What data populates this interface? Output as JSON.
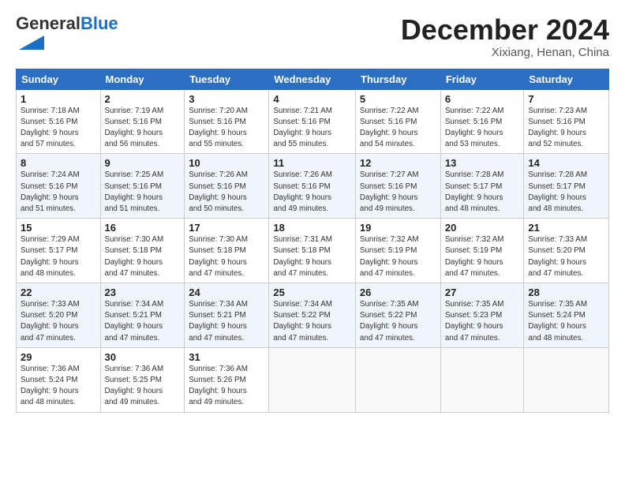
{
  "header": {
    "logo_general": "General",
    "logo_blue": "Blue",
    "month_title": "December 2024",
    "location": "Xixiang, Henan, China"
  },
  "weekdays": [
    "Sunday",
    "Monday",
    "Tuesday",
    "Wednesday",
    "Thursday",
    "Friday",
    "Saturday"
  ],
  "weeks": [
    [
      {
        "day": "1",
        "info": "Sunrise: 7:18 AM\nSunset: 5:16 PM\nDaylight: 9 hours\nand 57 minutes."
      },
      {
        "day": "2",
        "info": "Sunrise: 7:19 AM\nSunset: 5:16 PM\nDaylight: 9 hours\nand 56 minutes."
      },
      {
        "day": "3",
        "info": "Sunrise: 7:20 AM\nSunset: 5:16 PM\nDaylight: 9 hours\nand 55 minutes."
      },
      {
        "day": "4",
        "info": "Sunrise: 7:21 AM\nSunset: 5:16 PM\nDaylight: 9 hours\nand 55 minutes."
      },
      {
        "day": "5",
        "info": "Sunrise: 7:22 AM\nSunset: 5:16 PM\nDaylight: 9 hours\nand 54 minutes."
      },
      {
        "day": "6",
        "info": "Sunrise: 7:22 AM\nSunset: 5:16 PM\nDaylight: 9 hours\nand 53 minutes."
      },
      {
        "day": "7",
        "info": "Sunrise: 7:23 AM\nSunset: 5:16 PM\nDaylight: 9 hours\nand 52 minutes."
      }
    ],
    [
      {
        "day": "8",
        "info": "Sunrise: 7:24 AM\nSunset: 5:16 PM\nDaylight: 9 hours\nand 51 minutes."
      },
      {
        "day": "9",
        "info": "Sunrise: 7:25 AM\nSunset: 5:16 PM\nDaylight: 9 hours\nand 51 minutes."
      },
      {
        "day": "10",
        "info": "Sunrise: 7:26 AM\nSunset: 5:16 PM\nDaylight: 9 hours\nand 50 minutes."
      },
      {
        "day": "11",
        "info": "Sunrise: 7:26 AM\nSunset: 5:16 PM\nDaylight: 9 hours\nand 49 minutes."
      },
      {
        "day": "12",
        "info": "Sunrise: 7:27 AM\nSunset: 5:16 PM\nDaylight: 9 hours\nand 49 minutes."
      },
      {
        "day": "13",
        "info": "Sunrise: 7:28 AM\nSunset: 5:17 PM\nDaylight: 9 hours\nand 48 minutes."
      },
      {
        "day": "14",
        "info": "Sunrise: 7:28 AM\nSunset: 5:17 PM\nDaylight: 9 hours\nand 48 minutes."
      }
    ],
    [
      {
        "day": "15",
        "info": "Sunrise: 7:29 AM\nSunset: 5:17 PM\nDaylight: 9 hours\nand 48 minutes."
      },
      {
        "day": "16",
        "info": "Sunrise: 7:30 AM\nSunset: 5:18 PM\nDaylight: 9 hours\nand 47 minutes."
      },
      {
        "day": "17",
        "info": "Sunrise: 7:30 AM\nSunset: 5:18 PM\nDaylight: 9 hours\nand 47 minutes."
      },
      {
        "day": "18",
        "info": "Sunrise: 7:31 AM\nSunset: 5:18 PM\nDaylight: 9 hours\nand 47 minutes."
      },
      {
        "day": "19",
        "info": "Sunrise: 7:32 AM\nSunset: 5:19 PM\nDaylight: 9 hours\nand 47 minutes."
      },
      {
        "day": "20",
        "info": "Sunrise: 7:32 AM\nSunset: 5:19 PM\nDaylight: 9 hours\nand 47 minutes."
      },
      {
        "day": "21",
        "info": "Sunrise: 7:33 AM\nSunset: 5:20 PM\nDaylight: 9 hours\nand 47 minutes."
      }
    ],
    [
      {
        "day": "22",
        "info": "Sunrise: 7:33 AM\nSunset: 5:20 PM\nDaylight: 9 hours\nand 47 minutes."
      },
      {
        "day": "23",
        "info": "Sunrise: 7:34 AM\nSunset: 5:21 PM\nDaylight: 9 hours\nand 47 minutes."
      },
      {
        "day": "24",
        "info": "Sunrise: 7:34 AM\nSunset: 5:21 PM\nDaylight: 9 hours\nand 47 minutes."
      },
      {
        "day": "25",
        "info": "Sunrise: 7:34 AM\nSunset: 5:22 PM\nDaylight: 9 hours\nand 47 minutes."
      },
      {
        "day": "26",
        "info": "Sunrise: 7:35 AM\nSunset: 5:22 PM\nDaylight: 9 hours\nand 47 minutes."
      },
      {
        "day": "27",
        "info": "Sunrise: 7:35 AM\nSunset: 5:23 PM\nDaylight: 9 hours\nand 47 minutes."
      },
      {
        "day": "28",
        "info": "Sunrise: 7:35 AM\nSunset: 5:24 PM\nDaylight: 9 hours\nand 48 minutes."
      }
    ],
    [
      {
        "day": "29",
        "info": "Sunrise: 7:36 AM\nSunset: 5:24 PM\nDaylight: 9 hours\nand 48 minutes."
      },
      {
        "day": "30",
        "info": "Sunrise: 7:36 AM\nSunset: 5:25 PM\nDaylight: 9 hours\nand 49 minutes."
      },
      {
        "day": "31",
        "info": "Sunrise: 7:36 AM\nSunset: 5:26 PM\nDaylight: 9 hours\nand 49 minutes."
      },
      null,
      null,
      null,
      null
    ]
  ]
}
